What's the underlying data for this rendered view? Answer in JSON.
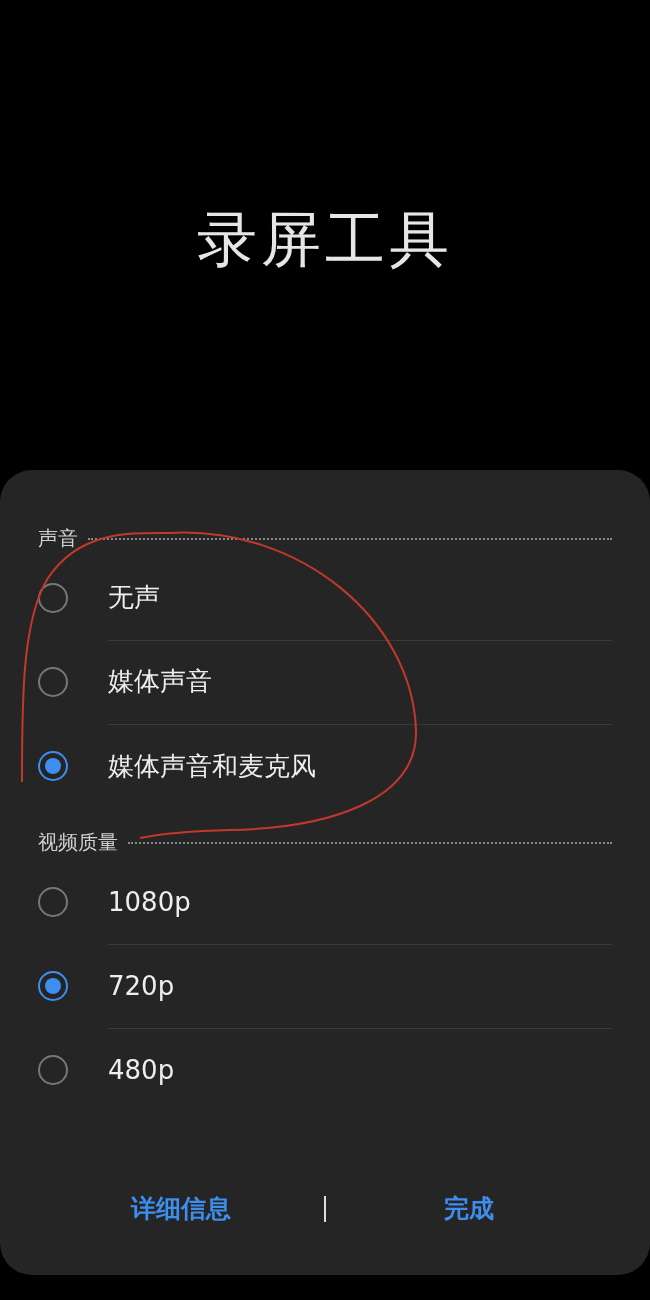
{
  "title": "录屏工具",
  "sections": [
    {
      "title": "声音",
      "options": [
        {
          "label": "无声",
          "selected": false
        },
        {
          "label": "媒体声音",
          "selected": false
        },
        {
          "label": "媒体声音和麦克风",
          "selected": true
        }
      ]
    },
    {
      "title": "视频质量",
      "options": [
        {
          "label": "1080p",
          "selected": false
        },
        {
          "label": "720p",
          "selected": true
        },
        {
          "label": "480p",
          "selected": false
        }
      ]
    }
  ],
  "buttons": [
    "详细信息",
    "完成"
  ]
}
